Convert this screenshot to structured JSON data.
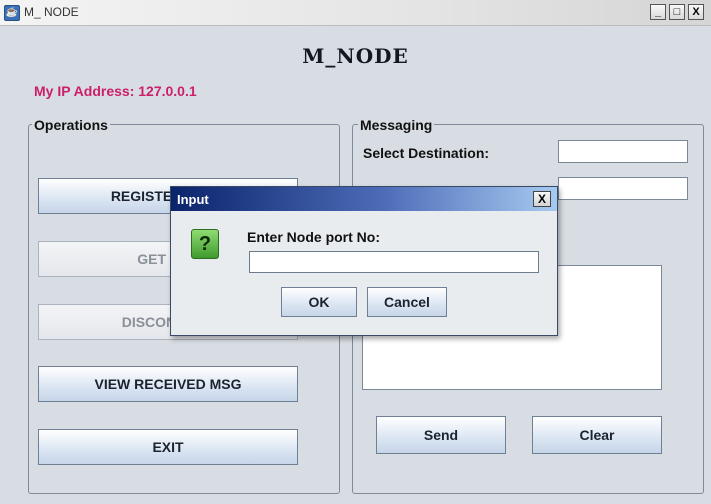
{
  "window": {
    "title": "M_ NODE",
    "icon": "java-cup-icon",
    "controls": {
      "minimize": "_",
      "maximize": "□",
      "close": "X"
    }
  },
  "header": {
    "heading": "M_NODE",
    "ip_label": "My IP Address: 127.0.0.1"
  },
  "operations": {
    "title": "Operations",
    "buttons": [
      {
        "label": "REGISTER USER",
        "enabled": true
      },
      {
        "label": "GET KEY",
        "enabled": false
      },
      {
        "label": "DISCONNECT",
        "enabled": false
      },
      {
        "label": "VIEW RECEIVED MSG",
        "enabled": true
      },
      {
        "label": "EXIT",
        "enabled": true
      }
    ]
  },
  "messaging": {
    "title": "Messaging",
    "destination_label": "Select Destination:",
    "destination_value": "",
    "second_field_value": "",
    "message_text": "",
    "send_label": "Send",
    "clear_label": "Clear"
  },
  "dialog": {
    "title": "Input",
    "icon": "question-icon",
    "icon_glyph": "?",
    "prompt": "Enter Node port No:",
    "input_value": "",
    "ok_label": "OK",
    "cancel_label": "Cancel",
    "close_glyph": "X"
  },
  "colors": {
    "ip_label": "#cc1f6a",
    "dialog_titlebar": "#0a246a",
    "window_bg": "#d8dde3"
  }
}
